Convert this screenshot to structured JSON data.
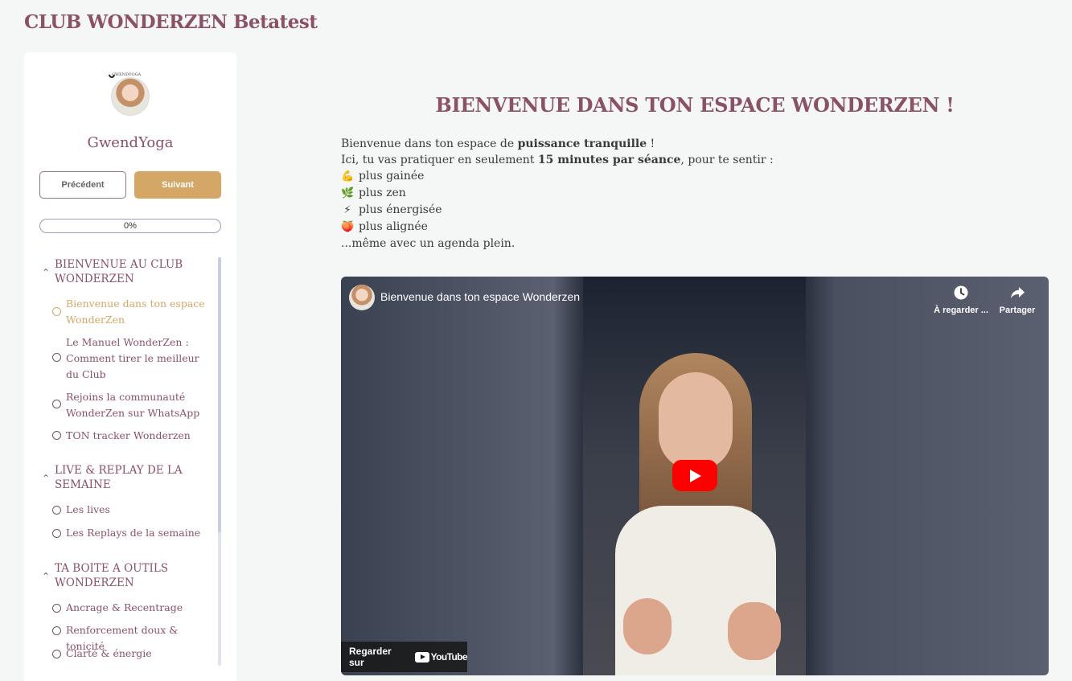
{
  "site": {
    "title": "CLUB WONDERZEN Betatest"
  },
  "profile": {
    "logo_text": "GWENDYOGA",
    "name": "GwendYoga"
  },
  "nav_buttons": {
    "prev_label": "Précédent",
    "next_label": "Suivant"
  },
  "progress": {
    "label": "0%",
    "value": 0
  },
  "sections": [
    {
      "title": "BIENVENUE AU CLUB WONDERZEN",
      "lessons": [
        {
          "label": "Bienvenue dans ton espace WonderZen",
          "active": true
        },
        {
          "label": "Le Manuel WonderZen : Comment tirer le meilleur du Club",
          "active": false
        },
        {
          "label": "Rejoins la communauté WonderZen sur WhatsApp",
          "active": false
        },
        {
          "label": "TON tracker Wonderzen",
          "active": false
        }
      ]
    },
    {
      "title": "LIVE & REPLAY DE LA SEMAINE",
      "lessons": [
        {
          "label": "Les lives",
          "active": false
        },
        {
          "label": "Les Replays de la semaine",
          "active": false
        }
      ]
    },
    {
      "title": "TA BOITE A OUTILS WONDERZEN",
      "lessons": [
        {
          "label": "Ancrage & Recentrage",
          "active": false
        },
        {
          "label": "Renforcement doux & tonicité",
          "active": false
        },
        {
          "label": "Clarté & énergie",
          "active": false
        }
      ]
    }
  ],
  "content": {
    "heading": "BIENVENUE DANS TON ESPACE WONDERZEN !",
    "line1_pre": "Bienvenue dans ton espace de ",
    "line1_bold": "puissance tranquille",
    "line1_post": " !",
    "line2_pre": "Ici, tu vas pratiquer en seulement ",
    "line2_bold": "15 minutes par séance",
    "line2_post": ", pour te sentir :",
    "bullets": [
      {
        "icon": "flexed-biceps-icon",
        "glyph": "💪",
        "text": "plus gainée"
      },
      {
        "icon": "herb-icon",
        "glyph": "🌿",
        "text": "plus zen"
      },
      {
        "icon": "lightning-icon",
        "glyph": "⚡",
        "text": "plus énergisée"
      },
      {
        "icon": "peach-icon",
        "glyph": "🍑",
        "text": "plus alignée"
      }
    ],
    "closing": "...même avec un agenda plein."
  },
  "video": {
    "title": "Bienvenue dans ton espace Wonderzen",
    "watch_later_label": "À regarder ...",
    "share_label": "Partager",
    "watch_on_label": "Regarder sur",
    "youtube_label": "YouTube"
  },
  "colors": {
    "brand": "#8b5264",
    "accent": "#d4a766",
    "background": "#f4f7f6"
  }
}
